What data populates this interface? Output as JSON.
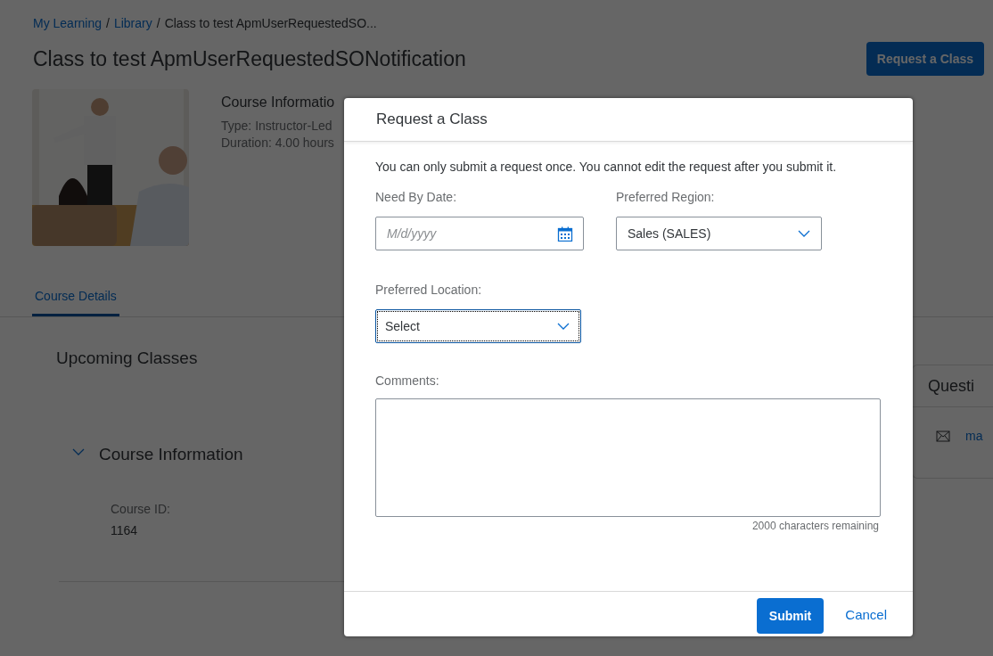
{
  "breadcrumb": [
    {
      "label": "My Learning",
      "kind": "link"
    },
    {
      "separator_before": "/",
      "label": "Library",
      "kind": "link"
    },
    {
      "separator_before": "/",
      "label": "Class to test ApmUserRequestedSO...",
      "kind": "current"
    }
  ],
  "page_title": "Class to test ApmUserRequestedSONotification",
  "header_button": "Request a Class",
  "course_summary": {
    "heading": "Course Informatio",
    "lines": [
      "Type: Instructor-Led",
      "Duration: 4.00 hours"
    ]
  },
  "tabs": [
    {
      "label": "Course Details",
      "selected": true
    }
  ],
  "upcoming_heading": "Upcoming Classes",
  "course_information": {
    "title": "Course Information",
    "expanded": true,
    "fields": [
      {
        "label": "Course ID:",
        "value": "1164"
      }
    ]
  },
  "side_card": {
    "title": "Questi",
    "link": "ma"
  },
  "dialog": {
    "title": "Request a Class",
    "notice": "You can only submit a request once. You cannot edit the request after you submit it.",
    "fields": [
      {
        "kind": "date",
        "label": "Need By Date:",
        "placeholder": "M/d/yyyy",
        "focused": false
      },
      {
        "kind": "select",
        "label": "Preferred Region:",
        "value": "Sales (SALES)",
        "focused": false
      },
      {
        "kind": "select",
        "label": "Preferred Location:",
        "value": "Select",
        "focused": true
      },
      {
        "kind": "textarea",
        "label": "Comments:",
        "counter": "2000 characters remaining",
        "focused": false
      }
    ],
    "buttons": [
      {
        "label": "Submit",
        "kind": "primary"
      },
      {
        "label": "Cancel",
        "kind": "link"
      }
    ]
  }
}
